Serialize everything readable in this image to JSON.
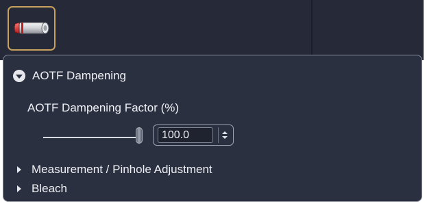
{
  "toolbar": {
    "tool_icon": "laser-attenuator-icon"
  },
  "panel": {
    "section_title": "AOTF Dampening",
    "factor_label": "AOTF Dampening Factor (%)",
    "factor_value": "100.0",
    "slider_fraction": 1.0,
    "collapsed_sections": [
      {
        "label": "Measurement / Pinhole Adjustment"
      },
      {
        "label": "Bleach"
      }
    ]
  },
  "colors": {
    "background": "#262a38",
    "panel": "#2b3040",
    "accent_border": "#c8a15f",
    "text": "#eef0f5"
  }
}
